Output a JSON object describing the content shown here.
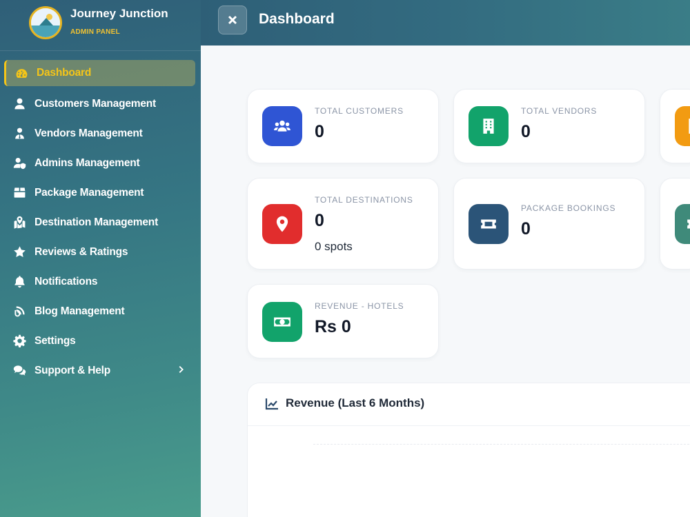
{
  "brand": {
    "title": "Journey Junction",
    "subtitle": "ADMIN PANEL"
  },
  "sidebar": {
    "items": [
      {
        "label": "Dashboard",
        "icon": "gauge-icon",
        "active": true
      },
      {
        "label": "Customers Management",
        "icon": "user-icon"
      },
      {
        "label": "Vendors Management",
        "icon": "user-tie-icon"
      },
      {
        "label": "Admins Management",
        "icon": "user-shield-icon"
      },
      {
        "label": "Package Management",
        "icon": "box-icon"
      },
      {
        "label": "Destination Management",
        "icon": "map-location-icon"
      },
      {
        "label": "Reviews & Ratings",
        "icon": "star-icon"
      },
      {
        "label": "Notifications",
        "icon": "bell-icon"
      },
      {
        "label": "Blog Management",
        "icon": "blog-icon"
      },
      {
        "label": "Settings",
        "icon": "gear-icon"
      },
      {
        "label": "Support & Help",
        "icon": "comments-icon",
        "expandable": true
      }
    ]
  },
  "header": {
    "title": "Dashboard",
    "close_icon": "close-icon"
  },
  "stats": {
    "customers": {
      "label": "TOTAL CUSTOMERS",
      "value": "0",
      "icon": "users-icon",
      "color": "#2f55d4"
    },
    "vendors": {
      "label": "TOTAL VENDORS",
      "value": "0",
      "icon": "building-icon",
      "color": "#12a36b"
    },
    "partial_top": {
      "icon": "hotel-icon",
      "color": "#f29b12"
    },
    "destinations": {
      "label": "TOTAL DESTINATIONS",
      "value": "0",
      "sub": "0 spots",
      "icon": "location-pin-icon",
      "color": "#e12d2d"
    },
    "bookings": {
      "label": "PACKAGE BOOKINGS",
      "value": "0",
      "icon": "ticket-icon",
      "color": "#2b5478"
    },
    "partial_mid": {
      "icon": "ticket-icon",
      "color": "#3f8a7a"
    },
    "revenue_hotels": {
      "label": "REVENUE - HOTELS",
      "value": "Rs 0",
      "icon": "money-bill-icon",
      "color": "#12a36b"
    }
  },
  "revenue_panel": {
    "title": "Revenue (Last 6 Months)",
    "icon": "chart-line-icon"
  }
}
